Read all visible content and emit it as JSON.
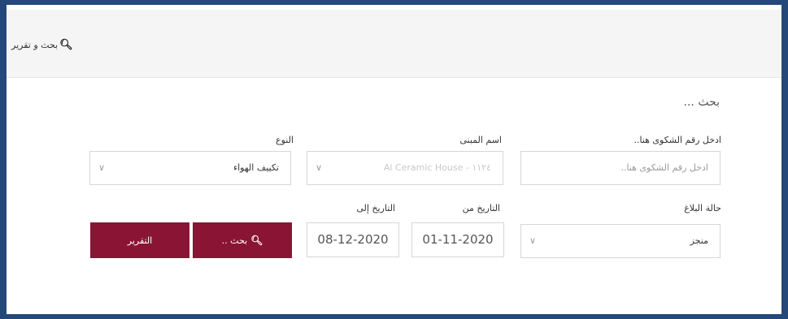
{
  "header": {
    "title": "بحث و تقرير",
    "icon": "search-icon"
  },
  "section": {
    "title": "بحث ..."
  },
  "form": {
    "complaint_number": {
      "label": "ادخل رقم الشكوى هنا..",
      "placeholder": "ادخل رقم الشكوى هنا..",
      "value": ""
    },
    "building_name": {
      "label": "اسم المبنى",
      "value": "Al Ceramic House - ۱۱۲٤"
    },
    "type": {
      "label": "النوع",
      "value": "تكييف الهواء"
    },
    "report_status": {
      "label": "حالة البلاغ",
      "value": "منجز"
    },
    "date_from": {
      "label": "التاريخ من",
      "value": "01-11-2020"
    },
    "date_to": {
      "label": "التاريخ إلى",
      "value": "08-12-2020"
    }
  },
  "buttons": {
    "search": "بحث ..",
    "report": "التقرير"
  },
  "colors": {
    "frame": "#24487a",
    "primary": "#8a1433",
    "topbar": "#f5f5f5"
  }
}
